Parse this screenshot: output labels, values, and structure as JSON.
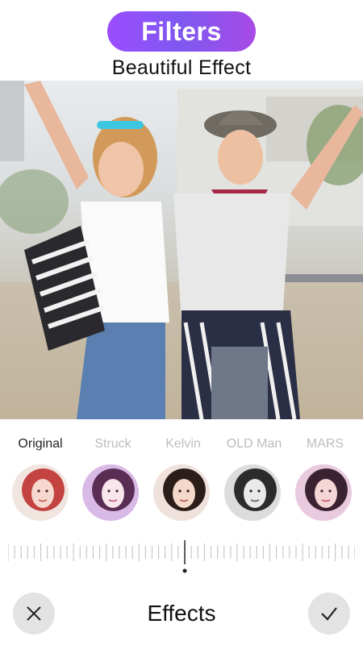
{
  "header": {
    "title": "Filters",
    "subtitle": "Beautiful Effect"
  },
  "photo": {
    "description_icon": "photo-two-women"
  },
  "filters": {
    "items": [
      {
        "label": "Original",
        "active": true
      },
      {
        "label": "Struck",
        "active": false
      },
      {
        "label": "Kelvin",
        "active": false
      },
      {
        "label": "OLD Man",
        "active": false
      },
      {
        "label": "MARS",
        "active": false
      }
    ]
  },
  "slider": {
    "value": 0.5
  },
  "bottom": {
    "title": "Effects",
    "cancel_icon": "close-icon",
    "confirm_icon": "check-icon"
  },
  "colors": {
    "accent_start": "#9b4dff",
    "accent_end": "#a84be6"
  }
}
